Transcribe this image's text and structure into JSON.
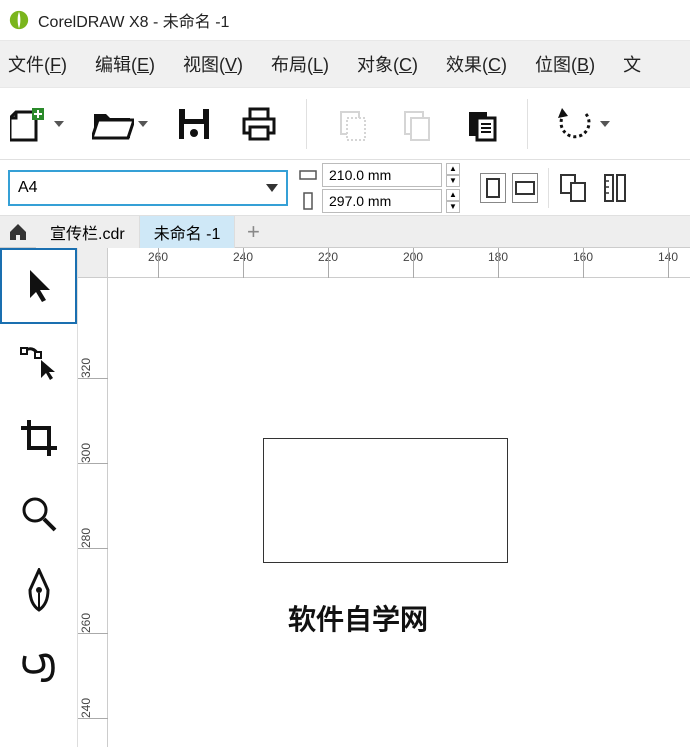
{
  "app": {
    "title": "CorelDRAW X8 - 未命名 -1"
  },
  "menu": {
    "file": "文件",
    "file_k": "F",
    "edit": "编辑",
    "edit_k": "E",
    "view": "视图",
    "view_k": "V",
    "layout": "布局",
    "layout_k": "L",
    "object": "对象",
    "object_k": "C",
    "effect": "效果",
    "effect_k": "C",
    "bitmap": "位图",
    "bitmap_k": "B",
    "text": "文"
  },
  "props": {
    "preset": "A4",
    "width": "210.0 mm",
    "height": "297.0 mm"
  },
  "tabs": {
    "t0": "宣传栏.cdr",
    "t1": "未命名 -1"
  },
  "ruler_h": {
    "l0": "260",
    "l1": "240",
    "l2": "220",
    "l3": "200",
    "l4": "180",
    "l5": "160",
    "l6": "140"
  },
  "ruler_v": {
    "l0": "320",
    "l1": "300",
    "l2": "280",
    "l3": "260",
    "l4": "240"
  },
  "canvas": {
    "text": "软件自学网"
  }
}
